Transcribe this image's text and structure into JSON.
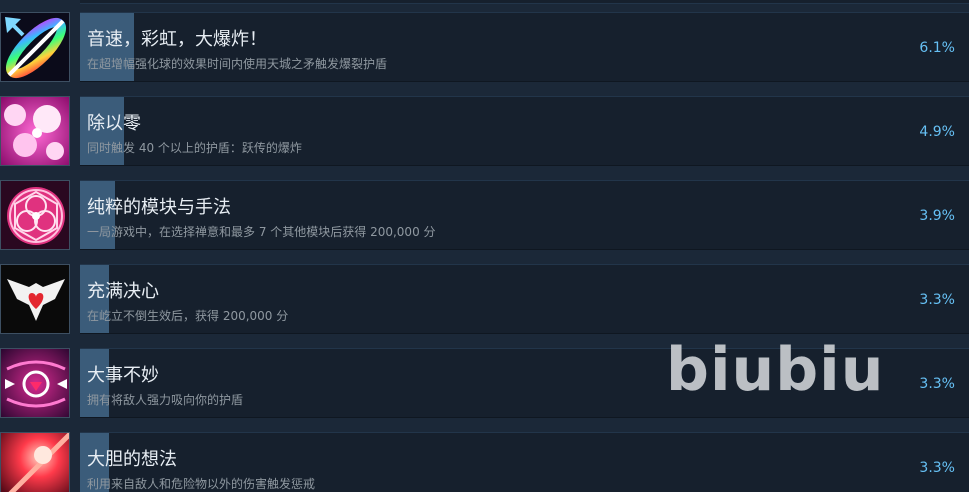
{
  "achievements": [
    {
      "title": "音速，彩虹，大爆炸！",
      "description": "在超增幅强化球的效果时间内使用天城之矛触发爆裂护盾",
      "percent": "6.1%",
      "percent_value": 6.1,
      "icon": "rainbow-sword-icon"
    },
    {
      "title": "除以零",
      "description": "同时触发 40 个以上的护盾：跃传的爆炸",
      "percent": "4.9%",
      "percent_value": 4.9,
      "icon": "pink-bubbles-icon"
    },
    {
      "title": "纯粹的模块与手法",
      "description": "一局游戏中，在选择禅意和最多 7 个其他模块后获得 200,000 分",
      "percent": "3.9%",
      "percent_value": 3.9,
      "icon": "sacred-geometry-icon"
    },
    {
      "title": "充满决心",
      "description": "在屹立不倒生效后，获得 200,000 分",
      "percent": "3.3%",
      "percent_value": 3.3,
      "icon": "winged-heart-icon"
    },
    {
      "title": "大事不妙",
      "description": "拥有将敌人强力吸向你的护盾",
      "percent": "3.3%",
      "percent_value": 3.3,
      "icon": "magnet-heart-icon"
    },
    {
      "title": "大胆的想法",
      "description": "利用来自敌人和危险物以外的伤害触发惩戒",
      "percent": "3.3%",
      "percent_value": 3.3,
      "icon": "red-burst-icon"
    }
  ],
  "watermark": "biubiu",
  "colors": {
    "background": "#1b2838",
    "bar": "#16202d",
    "progress_fill": "#3b5c7a",
    "title_text": "#e8eef4",
    "description_text": "#8f98a0",
    "percent_text": "#66c0f4"
  }
}
